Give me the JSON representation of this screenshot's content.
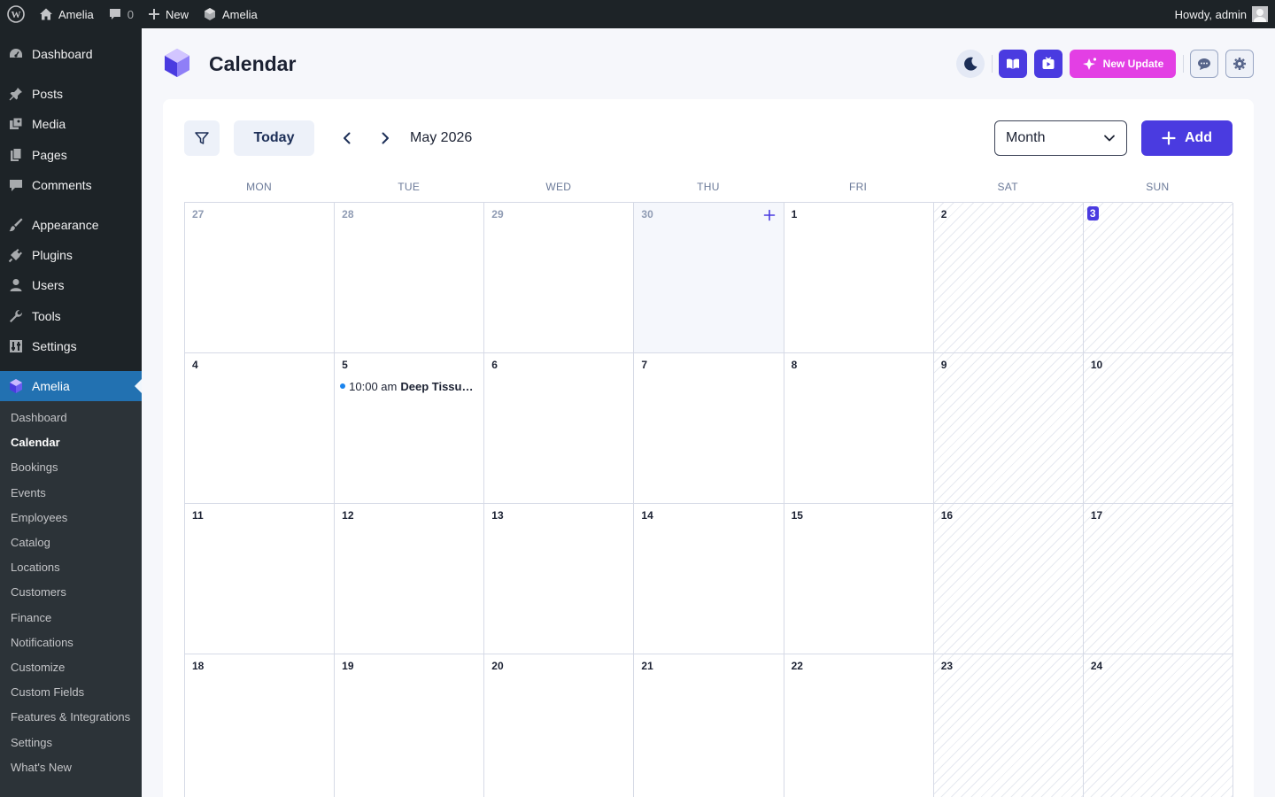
{
  "adminbar": {
    "site_name": "Amelia",
    "comments_count": "0",
    "new_label": "New",
    "plugin_label": "Amelia",
    "greeting": "Howdy, admin"
  },
  "sidebar": {
    "items": [
      {
        "label": "Dashboard",
        "icon": "dashboard-icon"
      },
      {
        "label": "Posts",
        "icon": "pin-icon"
      },
      {
        "label": "Media",
        "icon": "media-icon"
      },
      {
        "label": "Pages",
        "icon": "pages-icon"
      },
      {
        "label": "Comments",
        "icon": "comment-icon"
      },
      {
        "label": "Appearance",
        "icon": "brush-icon"
      },
      {
        "label": "Plugins",
        "icon": "plug-icon"
      },
      {
        "label": "Users",
        "icon": "user-icon"
      },
      {
        "label": "Tools",
        "icon": "wrench-icon"
      },
      {
        "label": "Settings",
        "icon": "settings-icon"
      },
      {
        "label": "Amelia",
        "icon": "amelia-icon"
      }
    ],
    "submenu": [
      "Dashboard",
      "Calendar",
      "Bookings",
      "Events",
      "Employees",
      "Catalog",
      "Locations",
      "Customers",
      "Finance",
      "Notifications",
      "Customize",
      "Custom Fields",
      "Features & Integrations",
      "Settings",
      "What's New"
    ],
    "current_submenu": "Calendar"
  },
  "header": {
    "title": "Calendar",
    "update_label": "New Update"
  },
  "toolbar": {
    "today_label": "Today",
    "month_label": "May 2026",
    "view_value": "Month",
    "add_label": "Add"
  },
  "calendar": {
    "weekdays": [
      "MON",
      "TUE",
      "WED",
      "THU",
      "FRI",
      "SAT",
      "SUN"
    ],
    "weeks": [
      [
        "27",
        "28",
        "29",
        "30",
        "1",
        "2",
        "3"
      ],
      [
        "4",
        "5",
        "6",
        "7",
        "8",
        "9",
        "10"
      ],
      [
        "11",
        "12",
        "13",
        "14",
        "15",
        "16",
        "17"
      ],
      [
        "18",
        "19",
        "20",
        "21",
        "22",
        "23",
        "24"
      ]
    ],
    "today": "3",
    "event": {
      "time": "10:00 am",
      "title": "Deep Tissue Massage",
      "day": "5",
      "color": "#1a84ee"
    }
  },
  "colors": {
    "accent": "#4a3be0",
    "update": "#e33fe4",
    "wp_active": "#2271b1"
  }
}
